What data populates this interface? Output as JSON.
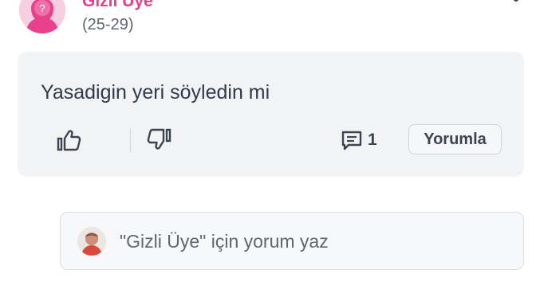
{
  "header": {
    "user_name": "Gizli Üye",
    "user_age": "(25-29)",
    "avatar_icon": "anonymous-female-avatar-icon",
    "avatar_badge": "?"
  },
  "question": {
    "text": "Yasadigin yeri söyledin mi",
    "like_icon": "thumbs-up-icon",
    "dislike_icon": "thumbs-down-icon",
    "comment_icon": "comment-icon",
    "comment_count": "1",
    "reply_label": "Yorumla"
  },
  "comment_input": {
    "placeholder": "\"Gizli Üye\" için yorum yaz",
    "avatar_icon": "user-avatar-icon"
  },
  "colors": {
    "brand_pink": "#e8408a",
    "avatar_pink": "#f7cfe0",
    "card_bg": "#f2f3f5",
    "text_dark": "#2e3b4a",
    "text_muted": "#5f6670"
  }
}
